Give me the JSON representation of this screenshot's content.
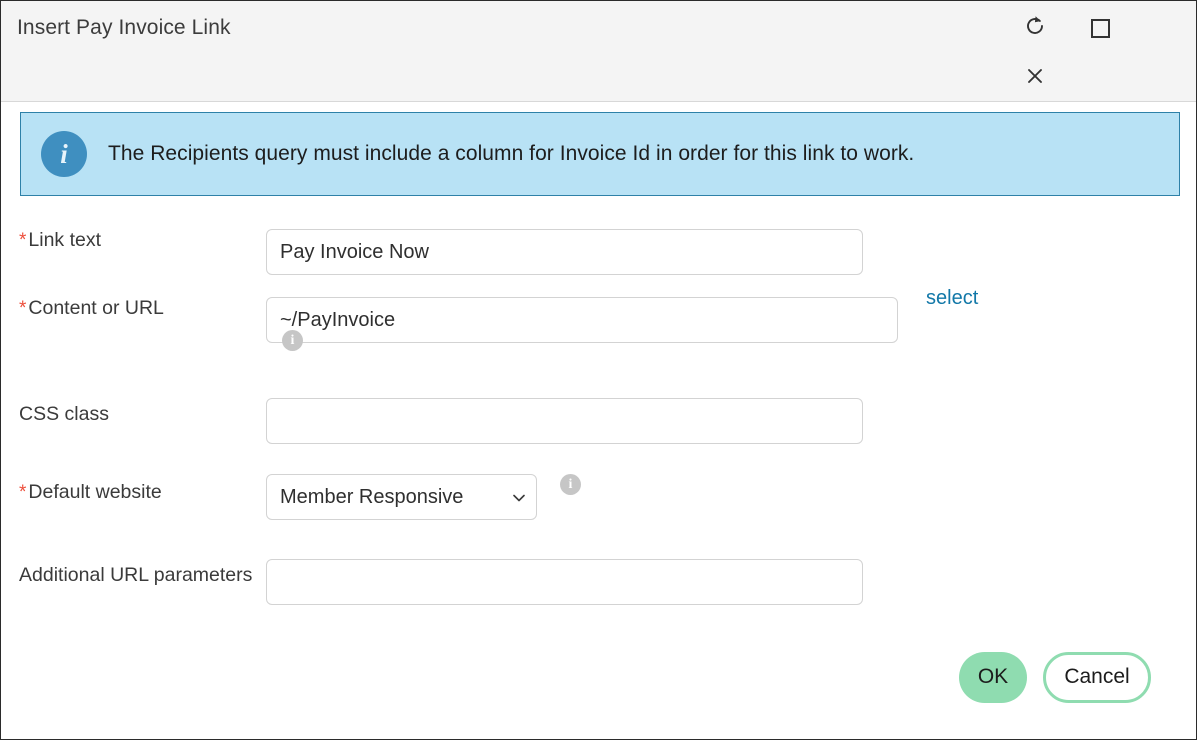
{
  "window": {
    "title": "Insert Pay Invoice Link",
    "controls": [
      {
        "name": "refresh",
        "label": "Refresh"
      },
      {
        "name": "maximize",
        "label": "Maximize"
      },
      {
        "name": "close",
        "label": "Close"
      }
    ]
  },
  "banner": {
    "icon": "info-icon",
    "message": "The Recipients query must include a column for Invoice Id in order for this link to work."
  },
  "form": {
    "link_text": {
      "label": "Link text",
      "required_marker": "*",
      "value": "Pay Invoice Now",
      "placeholder": ""
    },
    "content_or_url": {
      "label": "Content or URL",
      "required_marker": "*",
      "value": "~/PayInvoice",
      "placeholder": "",
      "select_link": "select",
      "info_glyph": "i"
    },
    "css_class": {
      "label": "CSS class",
      "value": "",
      "placeholder": ""
    },
    "default_website": {
      "label": "Default website",
      "required_marker": "*",
      "value": "Member Responsive",
      "options": [
        "Member Responsive"
      ],
      "info_glyph": "i"
    },
    "additional_url_parameters": {
      "label": "Additional URL parameters",
      "value": "",
      "placeholder": ""
    }
  },
  "footer": {
    "ok_label": "OK",
    "cancel_label": "Cancel"
  },
  "colors": {
    "banner_bg": "#b8e2f5",
    "banner_border": "#2e81a8",
    "banner_icon": "#3f8fc0",
    "required": "#ed4f3c",
    "link": "#1278a8",
    "accent_green": "#8fdcb0",
    "header_bg": "#f4f4f4"
  }
}
